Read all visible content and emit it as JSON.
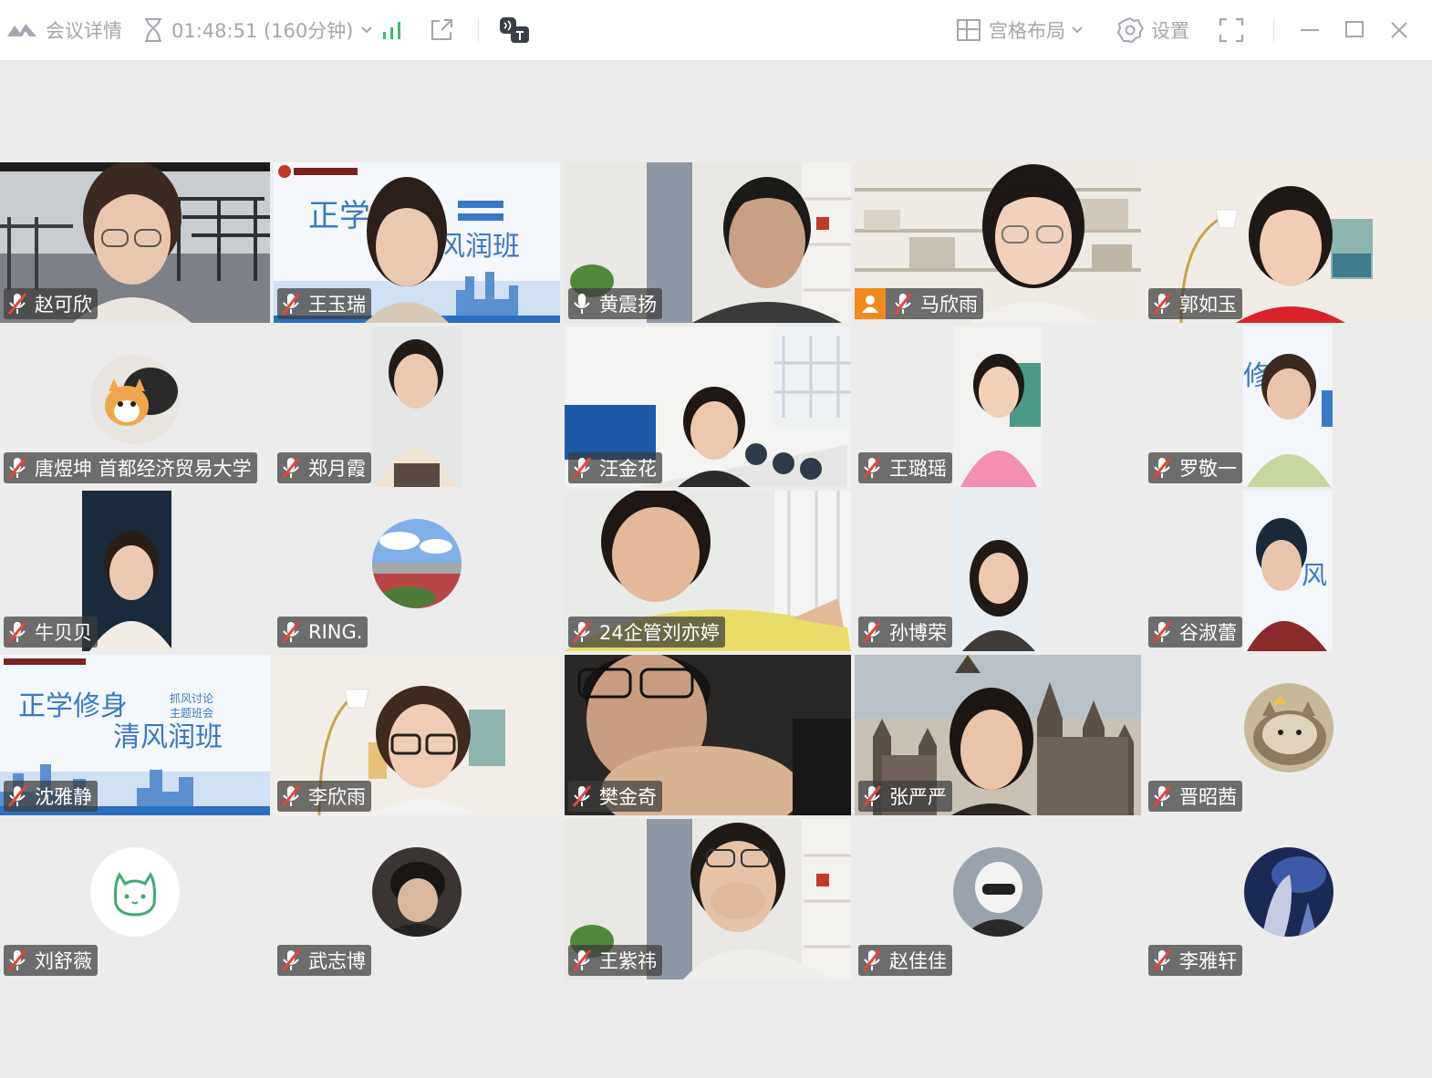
{
  "toolbar": {
    "meeting_details": "会议详情",
    "timer": "01:48:51 (160分钟)",
    "layout": "宫格布局",
    "settings": "设置"
  },
  "participants": [
    {
      "name": "赵可欣"
    },
    {
      "name": "王玉瑞"
    },
    {
      "name": "黄震扬"
    },
    {
      "name": "马欣雨"
    },
    {
      "name": "郭如玉"
    },
    {
      "name": "唐煜坤 首都经济贸易大学"
    },
    {
      "name": "郑月霞"
    },
    {
      "name": "汪金花"
    },
    {
      "name": "王璐瑶"
    },
    {
      "name": "罗敬一"
    },
    {
      "name": "牛贝贝"
    },
    {
      "name": "RING."
    },
    {
      "name": "24企管刘亦婷"
    },
    {
      "name": "孙博荣"
    },
    {
      "name": "谷淑蕾"
    },
    {
      "name": "沈雅静"
    },
    {
      "name": "李欣雨"
    },
    {
      "name": "樊金奇"
    },
    {
      "name": "张严严"
    },
    {
      "name": "晋昭茜"
    },
    {
      "name": "刘舒薇"
    },
    {
      "name": "武志博"
    },
    {
      "name": "王紫祎"
    },
    {
      "name": "赵佳佳"
    },
    {
      "name": "李雅轩"
    }
  ],
  "slide": {
    "title_line1": "正学修身",
    "title_line2": "清风润班",
    "tag1": "抓风讨论",
    "tag2": "主题班会"
  },
  "colors": {
    "host_badge": "#f08a1c",
    "signal": "#3cc06a",
    "toolbar_icon": "#a2a7b0",
    "slide_blue": "#3a78c8"
  }
}
